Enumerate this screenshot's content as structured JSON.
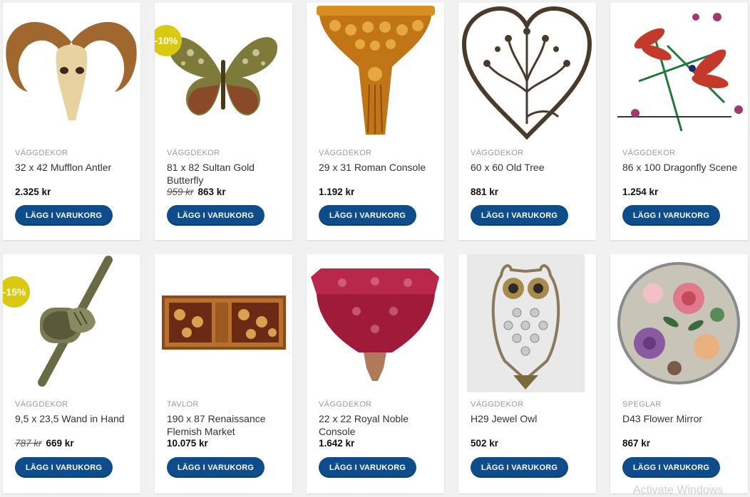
{
  "colors": {
    "button": "#0f4c8c",
    "badge": "#d9c911",
    "category": "#9a9a9a"
  },
  "products": [
    {
      "category": "VÄGGDEKOR",
      "name": "32 x 42 Mufflon Antler",
      "price": "2.325 kr",
      "old_price": "",
      "badge": "",
      "button": "LÄGG I VARUKORG",
      "image": "ram-skull-icon"
    },
    {
      "category": "VÄGGDEKOR",
      "name": "81 x 82 Sultan Gold Butterfly",
      "price": "863 kr",
      "old_price": "959 kr",
      "badge": "-10%",
      "button": "LÄGG I VARUKORG",
      "image": "butterfly-icon"
    },
    {
      "category": "VÄGGDEKOR",
      "name": "29 x 31 Roman Console",
      "price": "1.192 kr",
      "old_price": "",
      "badge": "",
      "button": "LÄGG I VARUKORG",
      "image": "console-icon"
    },
    {
      "category": "VÄGGDEKOR",
      "name": "60 x 60 Old Tree",
      "price": "881 kr",
      "old_price": "",
      "badge": "",
      "button": "LÄGG I VARUKORG",
      "image": "heart-tree-icon"
    },
    {
      "category": "VÄGGDEKOR",
      "name": "86 x 100 Dragonfly Scene",
      "price": "1.254 kr",
      "old_price": "",
      "badge": "",
      "button": "LÄGG I VARUKORG",
      "image": "dragonfly-icon"
    },
    {
      "category": "VÄGGDEKOR",
      "name": "9,5 x 23,5 Wand in Hand",
      "price": "669 kr",
      "old_price": "787 kr",
      "badge": "-15%",
      "button": "LÄGG I VARUKORG",
      "image": "hand-hook-icon"
    },
    {
      "category": "TAVLOR",
      "name": "190 x 87 Renaissance Flemish Market",
      "price": "10.075 kr",
      "old_price": "",
      "badge": "",
      "button": "LÄGG I VARUKORG",
      "image": "tapestry-icon"
    },
    {
      "category": "VÄGGDEKOR",
      "name": "22 x 22 Royal Noble Console",
      "price": "1.642 kr",
      "old_price": "",
      "badge": "",
      "button": "LÄGG I VARUKORG",
      "image": "red-console-icon"
    },
    {
      "category": "VÄGGDEKOR",
      "name": "H29 Jewel Owl",
      "price": "502 kr",
      "old_price": "",
      "badge": "",
      "button": "LÄGG I VARUKORG",
      "image": "owl-icon"
    },
    {
      "category": "SPEGLAR",
      "name": "D43 Flower Mirror",
      "price": "867 kr",
      "old_price": "",
      "badge": "",
      "button": "LÄGG I VARUKORG",
      "image": "flower-mirror-icon"
    }
  ],
  "watermark": "Activate Windows"
}
